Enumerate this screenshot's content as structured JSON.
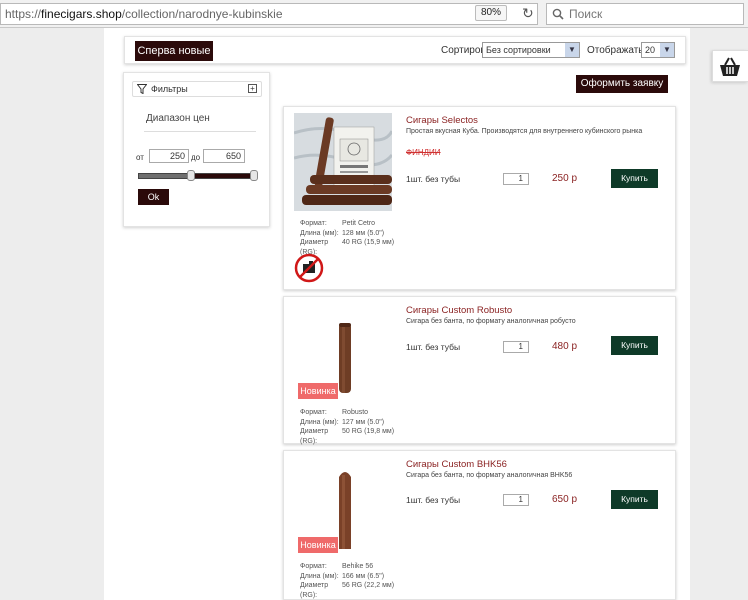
{
  "browser": {
    "url_scheme": "https://",
    "url_host": "finecigars.shop",
    "url_path": "/collection/narodnye-kubinskie",
    "zoom": "80%",
    "search_placeholder": "Поиск"
  },
  "toolbar": {
    "newest_label": "Сперва новые",
    "sort_label": "Сортировка",
    "sort_value": "Без сортировки",
    "show_label": "Отображать по",
    "show_value": "20"
  },
  "filters": {
    "title": "Фильтры",
    "price_range_title": "Диапазон цен",
    "from_label": "от",
    "from_value": "250",
    "to_label": "до",
    "to_value": "650",
    "ok_label": "Ok",
    "slider_min_fraction": 0.45,
    "slider_max_fraction": 1.0
  },
  "order_button": "Оформить заявку",
  "labels": {
    "format": "Формат:",
    "length": "Длина (мм):",
    "diameter": "Диаметр (RG):",
    "buy": "Купить",
    "new_badge": "Новинка"
  },
  "products": [
    {
      "name": "Сигары Selectos",
      "description": "Простая вкусная Куба. Производятся для внутреннего кубинского рынка",
      "strike_text": "ФИНДИИ",
      "unit": "1шт. без тубы",
      "qty": "1",
      "price": "250 р",
      "format": "Petit Cetro",
      "length": "128 мм (5.0\")",
      "diameter": "40 RG (15,9 мм)"
    },
    {
      "name": "Сигары Custom Robusto",
      "description": "Сигара без банта, по формату аналогичная робусто",
      "unit": "1шт. без тубы",
      "qty": "1",
      "price": "480 р",
      "format": "Robusto",
      "length": "127 мм (5.0\")",
      "diameter": "50 RG (19,8 мм)"
    },
    {
      "name": "Сигары Custom BHK56",
      "description": "Сигара без банта, по формату аналогичная BHK56",
      "unit": "1шт. без тубы",
      "qty": "1",
      "price": "650 р",
      "format": "Behike 56",
      "length": "166 мм (6.5\")",
      "diameter": "56 RG (22,2 мм)"
    }
  ],
  "colors": {
    "brand_dark": "#2b0a0a",
    "buy_green": "#0e3a28",
    "name_red": "#8b2323",
    "badge_red": "#ef6a6a"
  }
}
